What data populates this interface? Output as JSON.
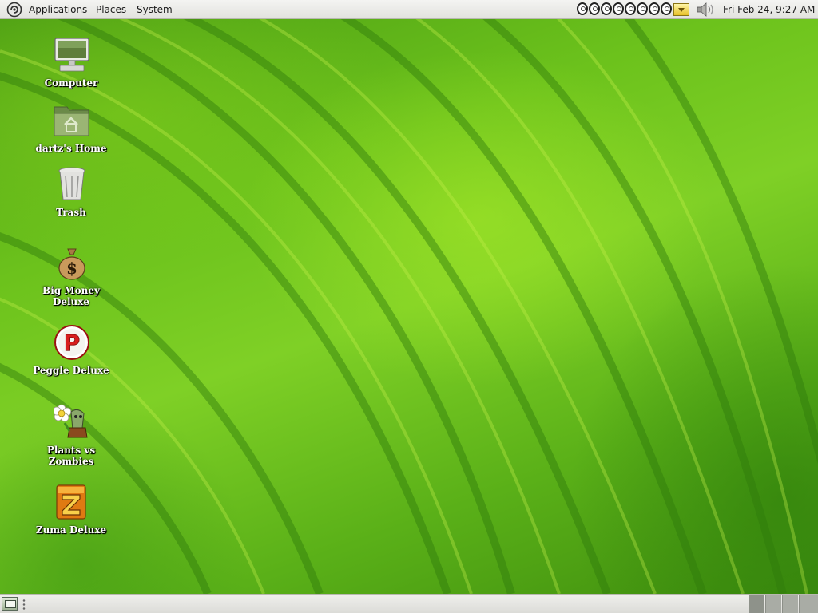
{
  "top_panel": {
    "menus": [
      {
        "label": "Applications"
      },
      {
        "label": "Places"
      },
      {
        "label": "System"
      }
    ],
    "logo_icon": "distro-logo-icon",
    "tray": {
      "app_indicator_count": 8,
      "notification_icon": "notification-area-icon",
      "volume_icon": "speaker-volume-icon"
    },
    "clock": "Fri Feb 24,  9:27 AM"
  },
  "desktop": {
    "wallpaper": "green leaf",
    "icons": [
      {
        "label": "Computer",
        "icon": "computer-icon"
      },
      {
        "label": "dartz's Home",
        "icon": "home-folder-icon"
      },
      {
        "label": "Trash",
        "icon": "trash-icon"
      },
      {
        "label": "Big Money Deluxe",
        "icon": "money-bag-icon"
      },
      {
        "label": "Peggle Deluxe",
        "icon": "peggle-icon"
      },
      {
        "label": "Plants vs Zombies",
        "icon": "plants-vs-zombies-icon"
      },
      {
        "label": "Zuma Deluxe",
        "icon": "zuma-icon"
      }
    ]
  },
  "bottom_panel": {
    "show_desktop_icon": "show-desktop-icon",
    "workspaces": 4,
    "active_workspace": 1
  },
  "colors": {
    "panel_bg": "#e8e8e4",
    "wallpaper_green": "#6cc21c",
    "label_text": "#ffffff"
  }
}
